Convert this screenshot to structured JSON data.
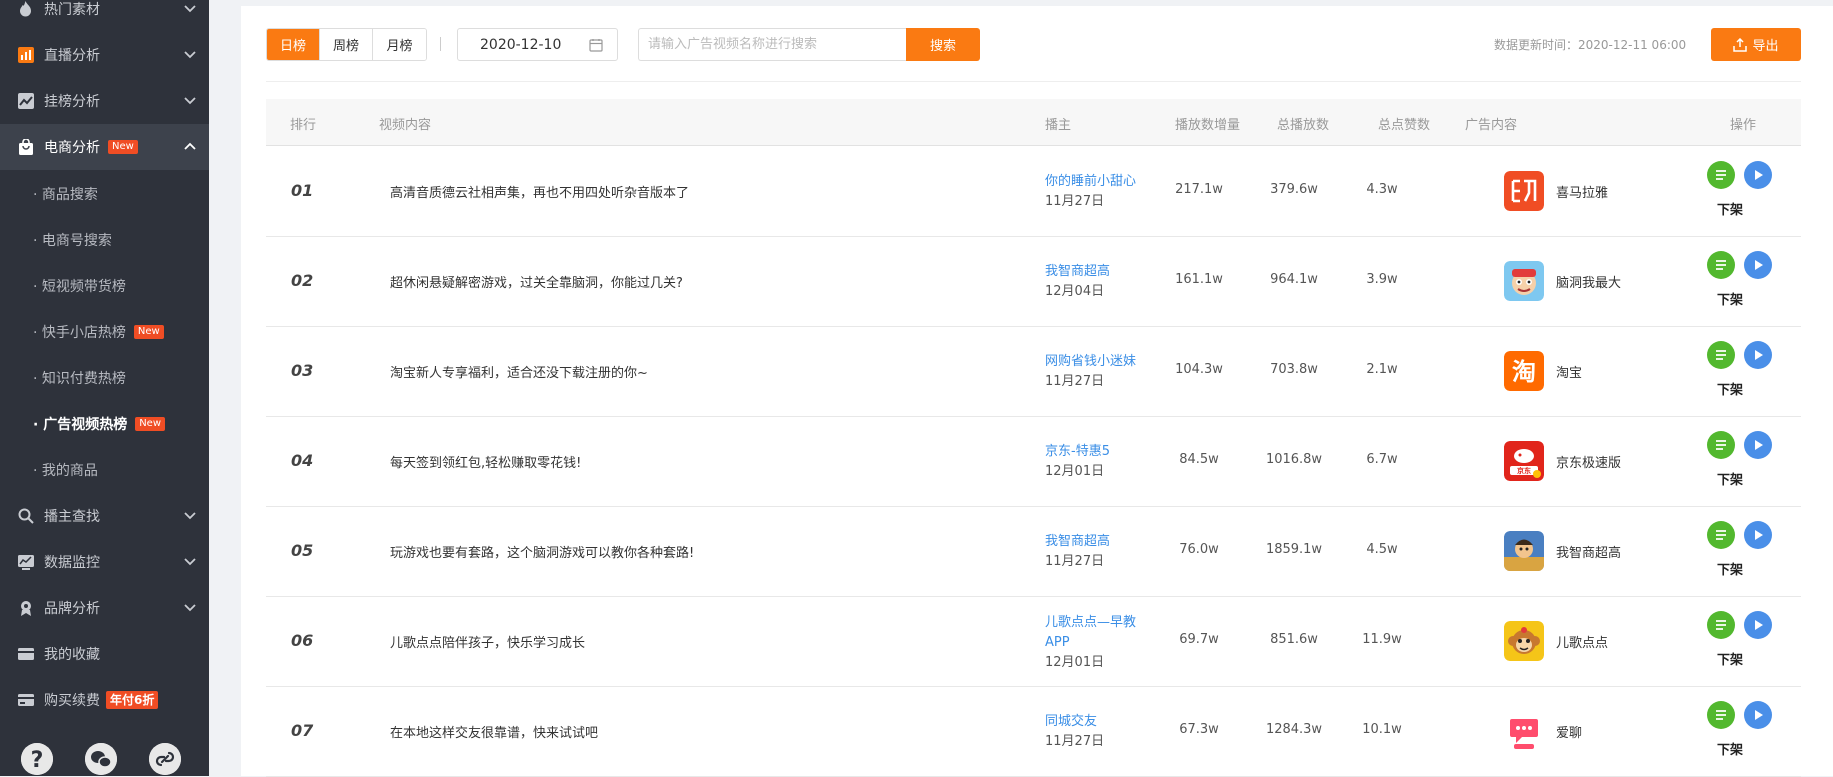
{
  "sidebar": {
    "items": [
      {
        "label": "热门素材",
        "icon": "flame-icon"
      },
      {
        "label": "直播分析",
        "icon": "bar-chart-icon"
      },
      {
        "label": "挂榜分析",
        "icon": "trend-icon"
      },
      {
        "label": "电商分析",
        "icon": "shopping-bag-icon",
        "badge": "New"
      }
    ],
    "subitems": [
      {
        "label": "· 商品搜索"
      },
      {
        "label": "· 电商号搜索"
      },
      {
        "label": "· 短视频带货榜"
      },
      {
        "label": "· 快手小店热榜",
        "badge": "New"
      },
      {
        "label": "· 知识付费热榜"
      },
      {
        "label": "· 广告视频热榜",
        "badge": "New"
      },
      {
        "label": "· 我的商品"
      }
    ],
    "items2": [
      {
        "label": "播主查找",
        "icon": "search-icon"
      },
      {
        "label": "数据监控",
        "icon": "monitor-icon"
      },
      {
        "label": "品牌分析",
        "icon": "brand-icon"
      },
      {
        "label": "我的收藏",
        "icon": "collect-icon"
      },
      {
        "label": "购买续费",
        "icon": "card-icon",
        "badge": "年付6折"
      }
    ],
    "bottom_icons": [
      "help-icon",
      "wechat-icon",
      "link-icon"
    ]
  },
  "toolbar": {
    "tabs": [
      "日榜",
      "周榜",
      "月榜"
    ],
    "date": "2020-12-10",
    "search_placeholder": "请输入广告视频名称进行搜索",
    "search_label": "搜索",
    "update_time": "数据更新时间：2020-12-11 06:00",
    "export_label": "导出"
  },
  "table": {
    "headers": [
      "排行",
      "视频内容",
      "播主",
      "播放数增量",
      "总播放数",
      "总点赞数",
      "广告内容",
      "操作"
    ],
    "rows": [
      {
        "rank": "01",
        "content": "高清音质德云社相声集，再也不用四处听杂音版本了",
        "anchor": "你的睡前小甜心",
        "date": "11月27日",
        "play_inc": "217.1w",
        "total_play": "379.6w",
        "likes": "4.3w",
        "ad_name": "喜马拉雅",
        "ad_icon": "ximalaya-icon",
        "ad_color": "#f04d24",
        "op": "下架"
      },
      {
        "rank": "02",
        "content": "超休闲悬疑解密游戏，过关全靠脑洞，你能过几关?",
        "anchor": "我智商超高",
        "date": "12月04日",
        "play_inc": "161.1w",
        "total_play": "964.1w",
        "likes": "3.9w",
        "ad_name": "脑洞我最大",
        "ad_icon": "game-face-icon",
        "ad_color": "#7ec8f0",
        "op": "下架"
      },
      {
        "rank": "03",
        "content": "淘宝新人专享福利，适合还没下载注册的你~",
        "anchor": "网购省钱小迷妹",
        "date": "11月27日",
        "play_inc": "104.3w",
        "total_play": "703.8w",
        "likes": "2.1w",
        "ad_name": "淘宝",
        "ad_icon": "taobao-icon",
        "ad_color": "#ff6a00",
        "op": "下架"
      },
      {
        "rank": "04",
        "content": "每天签到领红包,轻松赚取零花钱!",
        "anchor": "京东-特惠5",
        "date": "12月01日",
        "play_inc": "84.5w",
        "total_play": "1016.8w",
        "likes": "6.7w",
        "ad_name": "京东极速版",
        "ad_icon": "jd-icon",
        "ad_color": "#e1251b",
        "op": "下架"
      },
      {
        "rank": "05",
        "content": "玩游戏也要有套路，这个脑洞游戏可以教你各种套路!",
        "anchor": "我智商超高",
        "date": "11月27日",
        "play_inc": "76.0w",
        "total_play": "1859.1w",
        "likes": "4.5w",
        "ad_name": "我智商超高",
        "ad_icon": "game-character-icon",
        "ad_color": "#4a7fc1",
        "op": "下架"
      },
      {
        "rank": "06",
        "content": "儿歌点点陪伴孩子，快乐学习成长",
        "anchor": "儿歌点点—早教APP",
        "date": "12月01日",
        "play_inc": "69.7w",
        "total_play": "851.6w",
        "likes": "11.9w",
        "ad_name": "儿歌点点",
        "ad_icon": "monkey-icon",
        "ad_color": "#f5c518",
        "op": "下架"
      },
      {
        "rank": "07",
        "content": "在本地这样交友很靠谱，快来试试吧",
        "anchor": "同城交友",
        "date": "11月27日",
        "play_inc": "67.3w",
        "total_play": "1284.3w",
        "likes": "10.1w",
        "ad_name": "爱聊",
        "ad_icon": "chat-bubble-icon",
        "ad_color": "#ff4d6d",
        "op": "下架"
      }
    ]
  },
  "colors": {
    "accent": "#fa7a12",
    "sidebar_bg": "#2e323b",
    "link": "#3a8ee6",
    "new_badge": "#f04d24"
  }
}
